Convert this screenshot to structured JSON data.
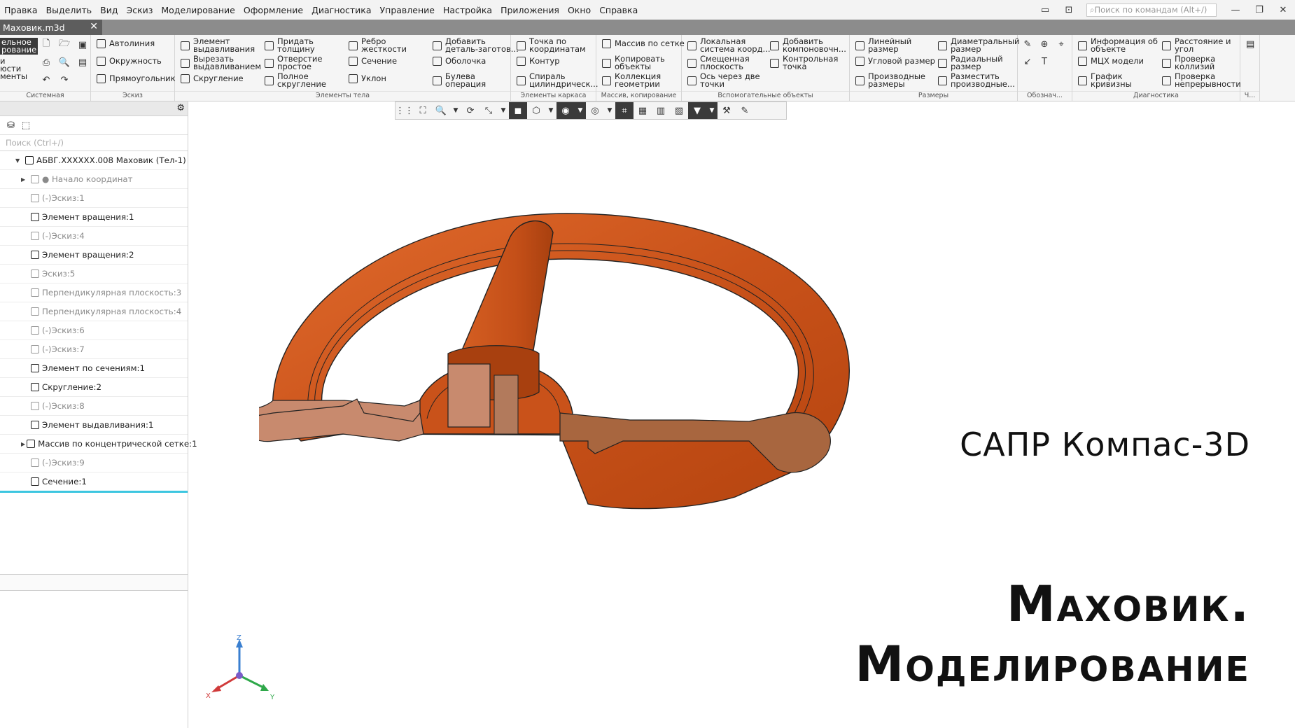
{
  "menu": [
    "Правка",
    "Выделить",
    "Вид",
    "Эскиз",
    "Моделирование",
    "Оформление",
    "Диагностика",
    "Управление",
    "Настройка",
    "Приложения",
    "Окно",
    "Справка"
  ],
  "top_search_placeholder": "Поиск по командам (Alt+/)",
  "document_tab": "Маховик.m3d",
  "ribbon": {
    "system_partial": [
      "ельное\nрование",
      "и\nюсти\nменты"
    ],
    "groups": {
      "sistemnaya": "Системная",
      "eskiz": "Эскиз",
      "elementy_tela": "Элементы тела",
      "elementy_karkasa": "Элементы каркаса",
      "massiv": "Массив, копирование",
      "vspomogatelnye": "Вспомогательные объекты",
      "razmery": "Размеры",
      "oboznach": "Обознач...",
      "diagnostika": "Диагностика",
      "ch": "Ч..."
    },
    "eskiz_buttons": [
      "Автолиния",
      "Окружность",
      "Прямоугольник"
    ],
    "body_col1": [
      "Элемент\nвыдавливания",
      "Вырезать\nвыдавливанием",
      "Скругление"
    ],
    "body_col2": [
      "Придать\nтолщину",
      "Отверстие\nпростое",
      "Полное\nскругление"
    ],
    "body_col3": [
      "Ребро\nжесткости",
      "Сечение",
      "Уклон"
    ],
    "body_col4": [
      "Добавить\nдеталь-заготов...",
      "Оболочка",
      "Булева\nоперация"
    ],
    "karkas": [
      "Точка по\nкоординатам",
      "Контур",
      "Спираль\nцилиндрическ..."
    ],
    "massiv_buttons": [
      "Массив по сетке",
      "Копировать\nобъекты",
      "Коллекция\nгеометрии"
    ],
    "vsp_col1": [
      "Локальная\nсистема коорд...",
      "Смещенная\nплоскость",
      "Ось через две\nточки"
    ],
    "vsp_col2": [
      "Добавить\nкомпоновочн...",
      "Контрольная\nточка"
    ],
    "razm_col1": [
      "Линейный\nразмер",
      "Угловой размер",
      "Производные\nразмеры"
    ],
    "razm_col2": [
      "Диаметральный\nразмер",
      "Радиальный\nразмер",
      "Разместить\nпроизводные..."
    ],
    "diag_col1": [
      "Информация об\nобъекте",
      "МЦХ модели",
      "График\nкривизны"
    ],
    "diag_col2": [
      "Расстояние и\nугол",
      "Проверка\nколлизий",
      "Проверка\nнепрерывности"
    ]
  },
  "tree": {
    "search_placeholder": "Поиск (Ctrl+/)",
    "rows": [
      {
        "label": "АБВГ.XXXXXX.008 Маховик (Тел-1)",
        "indent": 0,
        "dim": false,
        "icon": "part-icon"
      },
      {
        "label": "● Начало координат",
        "indent": 2,
        "dim": true,
        "icon": "origin-icon"
      },
      {
        "label": "(-)Эскиз:1",
        "indent": 3,
        "dim": true,
        "icon": "sketch-icon"
      },
      {
        "label": "Элемент вращения:1",
        "indent": 3,
        "dim": false,
        "icon": "revolve-icon"
      },
      {
        "label": "(-)Эскиз:4",
        "indent": 3,
        "dim": true,
        "icon": "sketch-icon"
      },
      {
        "label": "Элемент вращения:2",
        "indent": 3,
        "dim": false,
        "icon": "revolve-icon"
      },
      {
        "label": "Эскиз:5",
        "indent": 3,
        "dim": true,
        "icon": "sketch-icon"
      },
      {
        "label": "Перпендикулярная плоскость:3",
        "indent": 3,
        "dim": true,
        "icon": "plane-icon"
      },
      {
        "label": "Перпендикулярная плоскость:4",
        "indent": 3,
        "dim": true,
        "icon": "plane-icon"
      },
      {
        "label": "(-)Эскиз:6",
        "indent": 3,
        "dim": true,
        "icon": "sketch-icon"
      },
      {
        "label": "(-)Эскиз:7",
        "indent": 3,
        "dim": true,
        "icon": "sketch-icon"
      },
      {
        "label": "Элемент по сечениям:1",
        "indent": 3,
        "dim": false,
        "icon": "loft-icon"
      },
      {
        "label": "Скругление:2",
        "indent": 3,
        "dim": false,
        "icon": "fillet-icon"
      },
      {
        "label": "(-)Эскиз:8",
        "indent": 3,
        "dim": true,
        "icon": "sketch-icon"
      },
      {
        "label": "Элемент выдавливания:1",
        "indent": 3,
        "dim": false,
        "icon": "extrude-icon"
      },
      {
        "label": "Массив по концентрической сетке:1",
        "indent": 2,
        "dim": false,
        "icon": "pattern-icon"
      },
      {
        "label": "(-)Эскиз:9",
        "indent": 3,
        "dim": true,
        "icon": "sketch-icon"
      },
      {
        "label": "Сечение:1",
        "indent": 3,
        "dim": false,
        "icon": "section-icon",
        "selected": true
      }
    ]
  },
  "axes": {
    "z": "Z",
    "x": "X",
    "y": "Y"
  },
  "caption_app": "САПР Компас-3D",
  "caption_title_line1": "Маховик.",
  "caption_title_line2": "Моделирование",
  "colors": {
    "model": "#c9521a",
    "cut": "#c88a6e",
    "selection": "#3cc6e0"
  }
}
